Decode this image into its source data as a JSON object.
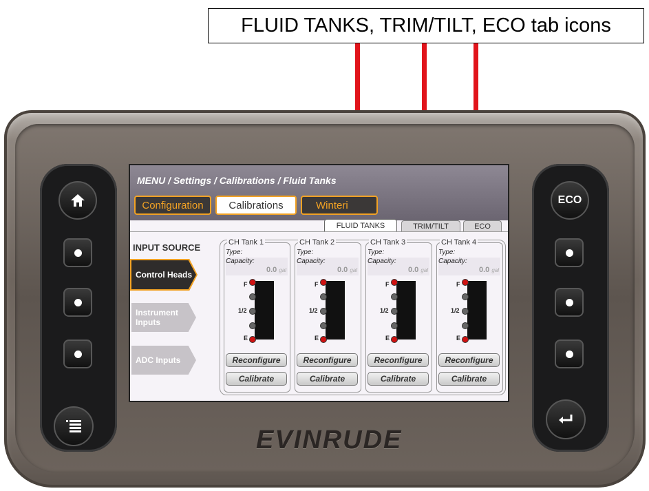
{
  "annotation": {
    "text": "FLUID TANKS, TRIM/TILT, ECO tab icons",
    "arrow_color": "#e1141b"
  },
  "device": {
    "brand": "EVINRUDE",
    "left_buttons": [
      "home-icon",
      "dot",
      "dot",
      "dot",
      "menu-icon"
    ],
    "right_buttons": [
      "eco-icon",
      "dot",
      "dot",
      "dot",
      "enter-icon"
    ],
    "eco_label": "ECO"
  },
  "screen": {
    "breadcrumb": "MENU / Settings / Calibrations / Fluid Tanks",
    "top_tabs": [
      "Configuration",
      "Calibrations",
      "Winterize"
    ],
    "top_tab_visible": [
      "Configuration",
      "Calibrations",
      "Winteri"
    ],
    "sub_tabs": [
      "FLUID TANKS",
      "TRIM/TILT",
      "ECO"
    ],
    "active_sub_tab": "FLUID TANKS",
    "input_source": {
      "title": "INPUT SOURCE",
      "items": [
        "Control Heads",
        "Instrument Inputs",
        "ADC Inputs"
      ],
      "active": "Control Heads"
    },
    "tanks": [
      {
        "name": "CH Tank 1",
        "type_label": "Type:",
        "capacity_label": "Capacity:",
        "capacity": "0.0",
        "unit": "gal",
        "full": "F",
        "half": "1/2",
        "empty": "E",
        "reconfigure": "Reconfigure",
        "calibrate": "Calibrate"
      },
      {
        "name": "CH Tank 2",
        "type_label": "Type:",
        "capacity_label": "Capacity:",
        "capacity": "0.0",
        "unit": "gal",
        "full": "F",
        "half": "1/2",
        "empty": "E",
        "reconfigure": "Reconfigure",
        "calibrate": "Calibrate"
      },
      {
        "name": "CH Tank 3",
        "type_label": "Type:",
        "capacity_label": "Capacity:",
        "capacity": "0.0",
        "unit": "gal",
        "full": "F",
        "half": "1/2",
        "empty": "E",
        "reconfigure": "Reconfigure",
        "calibrate": "Calibrate"
      },
      {
        "name": "CH Tank 4",
        "type_label": "Type:",
        "capacity_label": "Capacity:",
        "capacity": "0.0",
        "unit": "gal",
        "full": "F",
        "half": "1/2",
        "empty": "E",
        "reconfigure": "Reconfigure",
        "calibrate": "Calibrate"
      }
    ]
  },
  "colors": {
    "accent_orange": "#f2a224",
    "dark_button": "#2f2c2b",
    "gauge_marker_red": "#d01212"
  }
}
